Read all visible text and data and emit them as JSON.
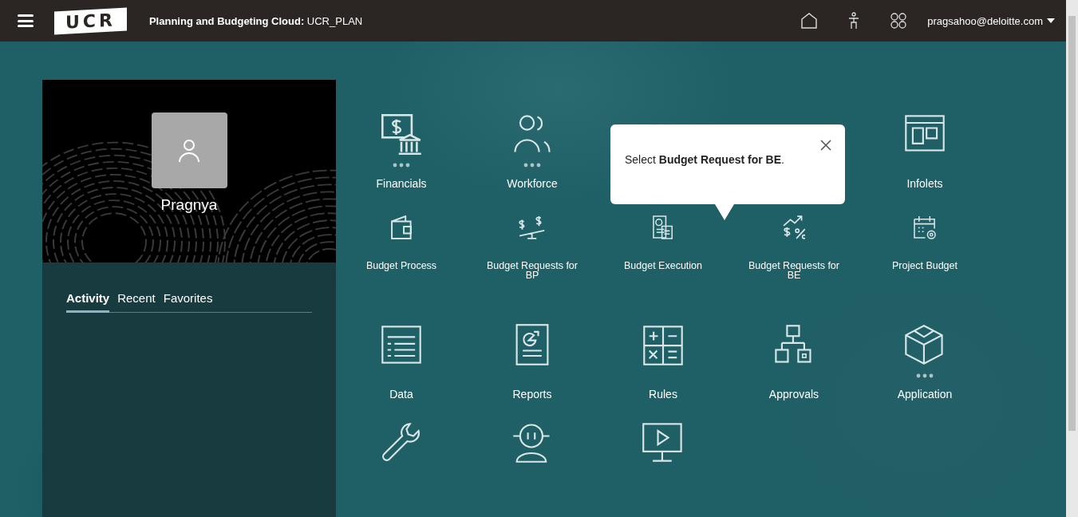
{
  "header": {
    "logo": "UCR",
    "title_bold": "Planning and Budgeting Cloud:",
    "title": "UCR_PLAN",
    "user": "pragsahoo@deloitte.com"
  },
  "profile": {
    "name": "Pragnya"
  },
  "tabs": [
    {
      "label": "Activity",
      "selected": true
    },
    {
      "label": "Recent",
      "selected": false
    },
    {
      "label": "Favorites",
      "selected": false
    }
  ],
  "rows": [
    {
      "tiles": [
        {
          "label": "Financials",
          "more": true
        },
        {
          "label": "Workforce",
          "more": true
        },
        {
          "label": "Infolets",
          "more": false
        }
      ]
    },
    {
      "tiles": [
        {
          "label": "Budget Process",
          "more": false
        },
        {
          "label": "Budget Requests for BP",
          "more": false
        },
        {
          "label": "Budget Execution",
          "more": false
        },
        {
          "label": "Budget Requests for BE",
          "more": false
        },
        {
          "label": "Project Budget",
          "more": false
        }
      ]
    },
    {
      "tiles": [
        {
          "label": "Data",
          "more": false
        },
        {
          "label": "Reports",
          "more": false
        },
        {
          "label": "Rules",
          "more": false
        },
        {
          "label": "Approvals",
          "more": false
        },
        {
          "label": "Application",
          "more": true
        }
      ]
    },
    {
      "tiles": [
        {
          "more": false
        },
        {
          "more": false
        },
        {
          "more": false
        }
      ]
    }
  ],
  "popup": {
    "text": "Select **Budget Request for BE**."
  }
}
